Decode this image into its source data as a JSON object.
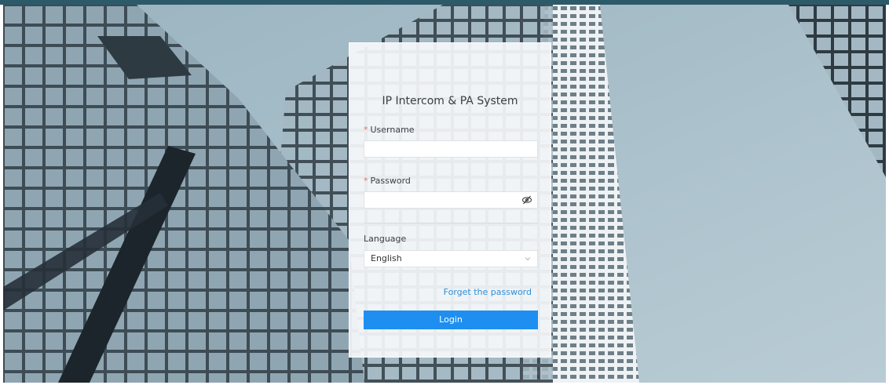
{
  "page": {
    "title": "IP Intercom & PA System"
  },
  "form": {
    "username": {
      "label": "Username",
      "required_mark": "*",
      "value": ""
    },
    "password": {
      "label": "Password",
      "required_mark": "*",
      "value": "",
      "toggle_icon": "eye-slash-icon"
    },
    "language": {
      "label": "Language",
      "selected": "English",
      "dropdown_icon": "chevron-down-icon"
    },
    "forgot_link": "Forget the password",
    "login_label": "Login"
  },
  "colors": {
    "primary": "#1e8ff0",
    "link": "#2f8fd8",
    "required": "#f26b6b",
    "top_bar": "#2c5a68"
  }
}
